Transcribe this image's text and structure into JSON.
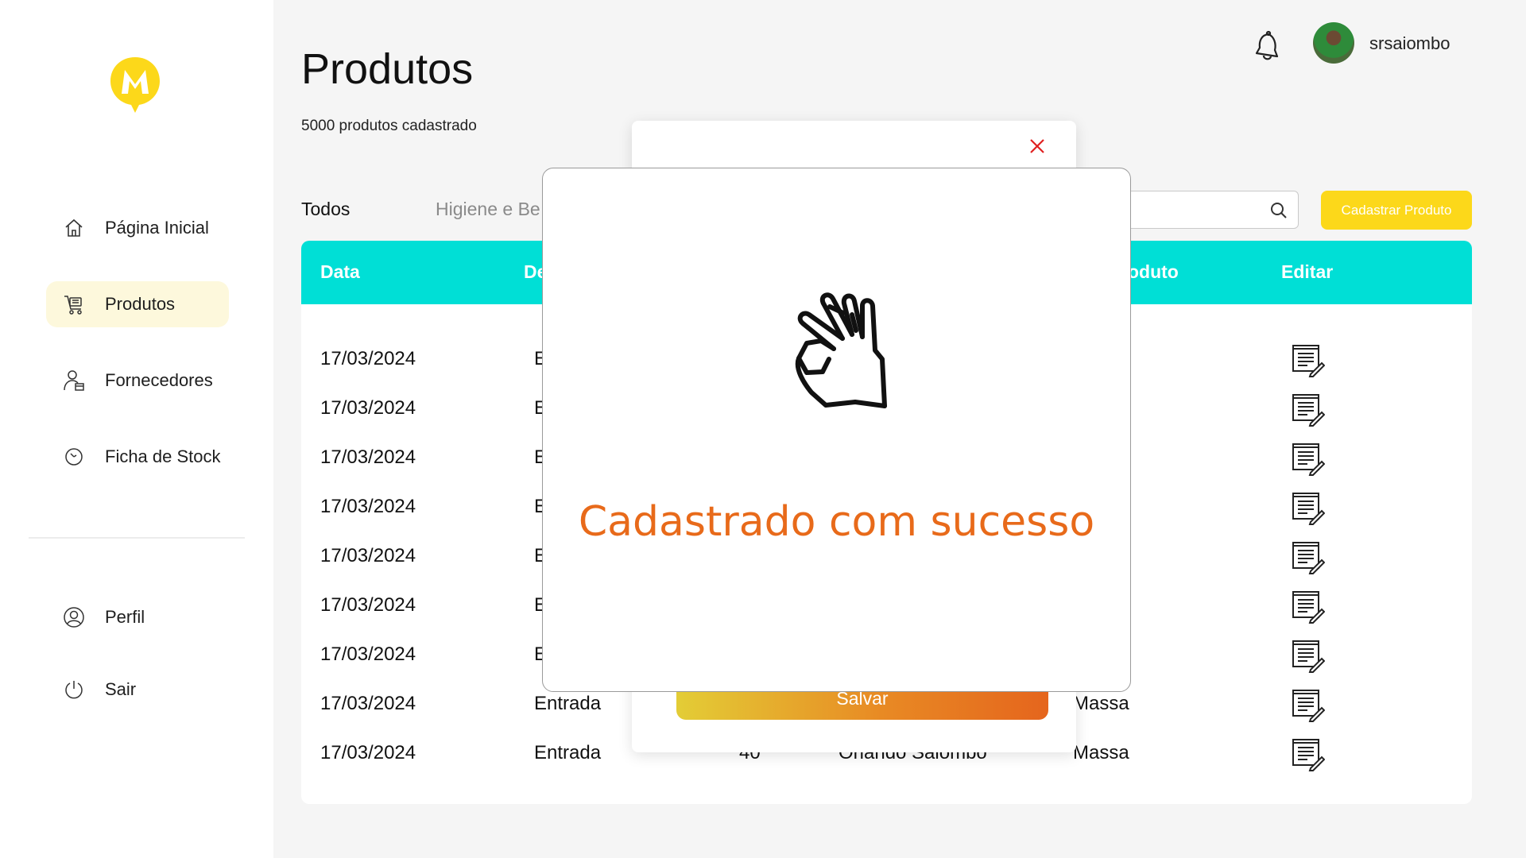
{
  "sidebar": {
    "items": [
      {
        "label": "Página Inicial",
        "icon": "home-icon"
      },
      {
        "label": "Produtos",
        "icon": "cart-icon"
      },
      {
        "label": "Fornecedores",
        "icon": "supplier-icon"
      },
      {
        "label": "Ficha de Stock",
        "icon": "clock-icon"
      }
    ],
    "bottom_items": [
      {
        "label": "Perfil",
        "icon": "user-circle-icon"
      },
      {
        "label": "Sair",
        "icon": "power-icon"
      }
    ]
  },
  "header": {
    "title": "Produtos",
    "subtitle": "5000 produtos cadastrado",
    "username": "srsaiombo"
  },
  "tabs": [
    {
      "label": "Todos"
    },
    {
      "label": "Higiene e Be"
    }
  ],
  "search": {
    "placeholder": ""
  },
  "actions": {
    "cadastrar_label": "Cadastrar Produto"
  },
  "table": {
    "headers": [
      "Data",
      "De",
      "oduto",
      "Editar"
    ],
    "rows": [
      {
        "data": "17/03/2024",
        "desc": "E",
        "qtd": "",
        "fornecedor": "",
        "produto": ""
      },
      {
        "data": "17/03/2024",
        "desc": "E",
        "qtd": "",
        "fornecedor": "",
        "produto": ""
      },
      {
        "data": "17/03/2024",
        "desc": "E",
        "qtd": "",
        "fornecedor": "",
        "produto": ""
      },
      {
        "data": "17/03/2024",
        "desc": "E",
        "qtd": "",
        "fornecedor": "",
        "produto": ""
      },
      {
        "data": "17/03/2024",
        "desc": "E",
        "qtd": "",
        "fornecedor": "",
        "produto": ""
      },
      {
        "data": "17/03/2024",
        "desc": "E",
        "qtd": "",
        "fornecedor": "",
        "produto": ""
      },
      {
        "data": "17/03/2024",
        "desc": "E",
        "qtd": "",
        "fornecedor": "",
        "produto": ""
      },
      {
        "data": "17/03/2024",
        "desc": "Entrada",
        "qtd": "",
        "fornecedor": "",
        "produto": "Massa"
      },
      {
        "data": "17/03/2024",
        "desc": "Entrada",
        "qtd": "40",
        "fornecedor": "Orlando Saiombo",
        "produto": "Massa"
      }
    ]
  },
  "form_modal": {
    "save_label": "Salvar"
  },
  "success_modal": {
    "message": "Cadastrado com sucesso"
  },
  "colors": {
    "accent_yellow": "#fcd81a",
    "table_header": "#00dfd6",
    "success_text": "#e86a1a",
    "active_nav_bg": "#fdf8dc"
  }
}
